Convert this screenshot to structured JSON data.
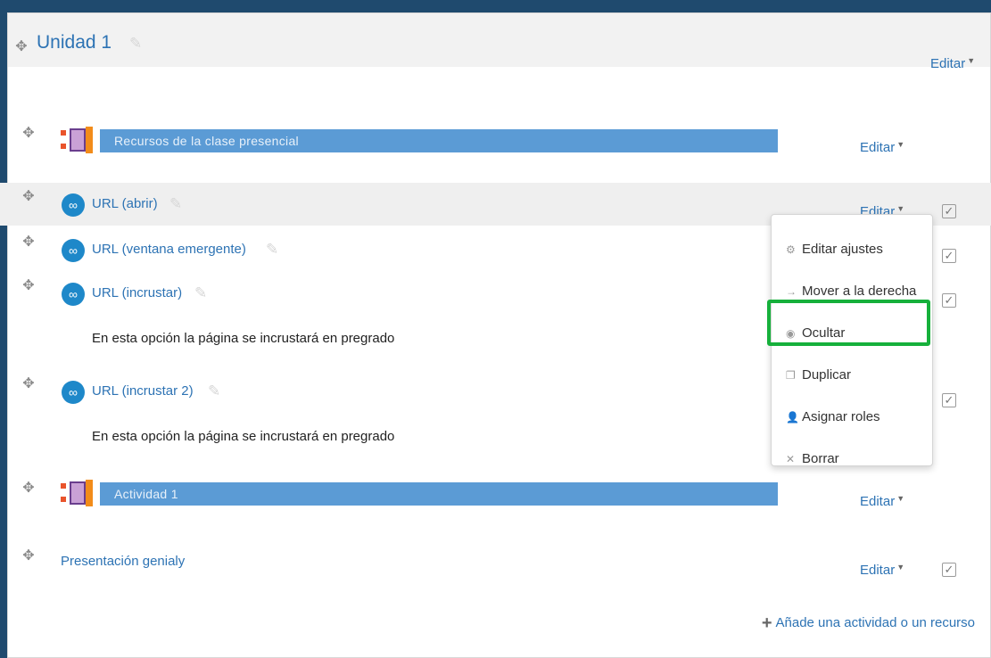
{
  "section": {
    "title": "Unidad 1",
    "edit_label": "Editar"
  },
  "rows": {
    "label1": {
      "text": "Recursos de la clase presencial",
      "edit": "Editar"
    },
    "url_abrir": {
      "label": "URL (abrir)",
      "edit": "Editar"
    },
    "url_popup": {
      "label": "URL (ventana emergente)"
    },
    "url_embed": {
      "label": "URL (incrustar)",
      "desc": "En esta opción la página se incrustará en pregrado"
    },
    "url_embed2": {
      "label": "URL (incrustar 2)",
      "desc": "En esta opción la página se incrustará en pregrado"
    },
    "label2": {
      "text": "Actividad 1",
      "edit": "Editar"
    },
    "genialy": {
      "label": "Presentación genialy",
      "edit": "Editar"
    }
  },
  "menu": {
    "items": [
      {
        "label": "Editar ajustes",
        "icon": "gear-icon"
      },
      {
        "label": "Mover a la derecha",
        "icon": "arrow-right-icon"
      },
      {
        "label": "Ocultar",
        "icon": "eye-icon"
      },
      {
        "label": "Duplicar",
        "icon": "duplicate-icon"
      },
      {
        "label": "Asignar roles",
        "icon": "user-icon"
      },
      {
        "label": "Borrar",
        "icon": "close-icon"
      }
    ]
  },
  "footer": {
    "add_label": "Añade una actividad o un recurso"
  },
  "colors": {
    "link": "#2d73b4",
    "label_bar": "#5b9bd5",
    "highlight": "#16b03b",
    "frame": "#1f4a6e"
  }
}
